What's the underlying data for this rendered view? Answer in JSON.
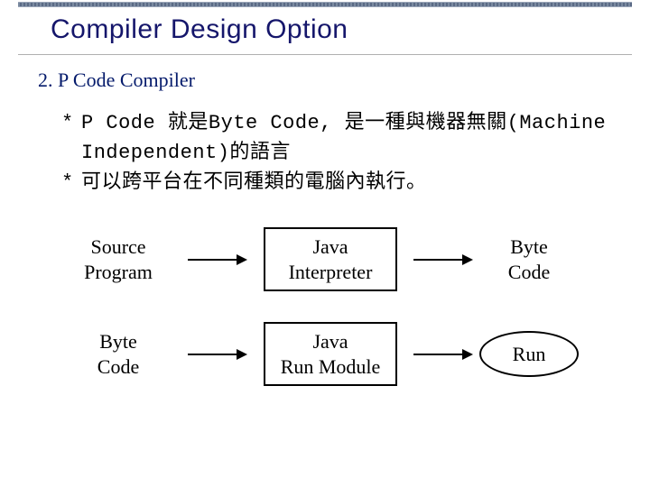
{
  "title": "Compiler Design Option",
  "subtitle": "2. P Code Compiler",
  "bullets": {
    "b1": "P Code 就是Byte Code, 是一種與機器無關(Machine Independent)的語言",
    "b2": "可以跨平台在不同種類的電腦內執行。"
  },
  "diagram": {
    "row1": {
      "n1_l1": "Source",
      "n1_l2": "Program",
      "n2_l1": "Java",
      "n2_l2": "Interpreter",
      "n3_l1": "Byte",
      "n3_l2": "Code"
    },
    "row2": {
      "n1_l1": "Byte",
      "n1_l2": "Code",
      "n2_l1": "Java",
      "n2_l2": "Run Module",
      "n3": "Run"
    }
  }
}
